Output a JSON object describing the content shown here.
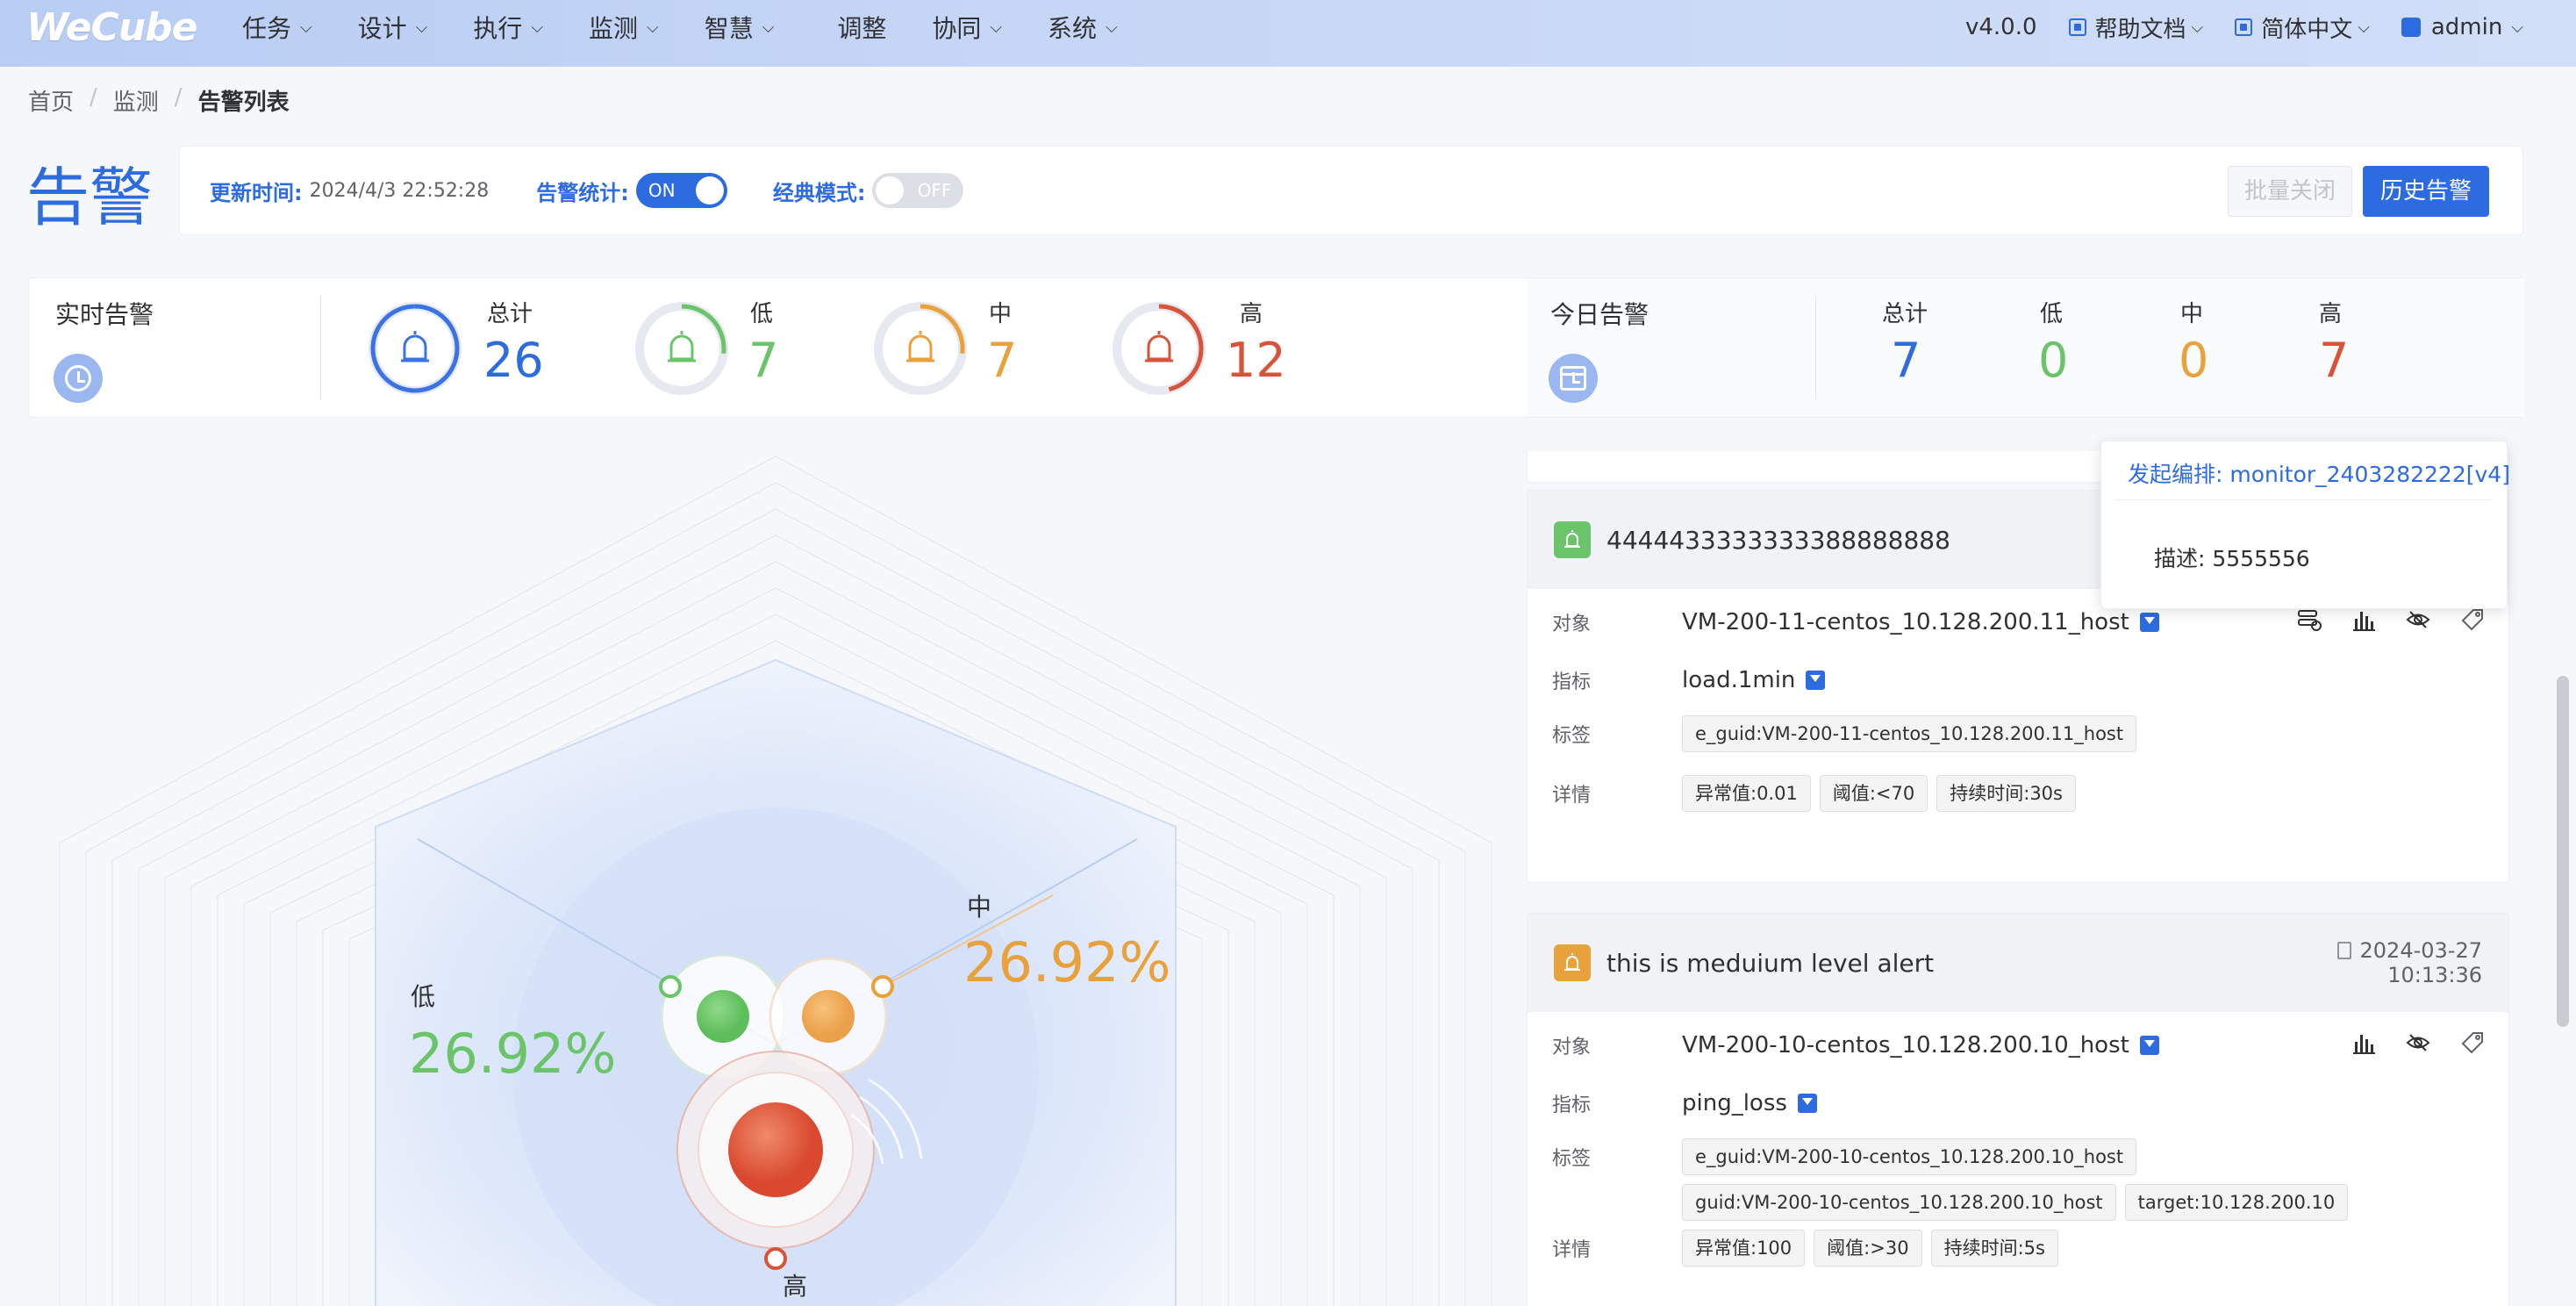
{
  "nav": {
    "logo": "WeCube",
    "items": [
      {
        "label": "任务",
        "chevron": true
      },
      {
        "label": "设计",
        "chevron": true
      },
      {
        "label": "执行",
        "chevron": true
      },
      {
        "label": "监测",
        "chevron": true
      },
      {
        "label": "智慧",
        "chevron": true
      },
      {
        "label": "调整",
        "chevron": false
      },
      {
        "label": "协同",
        "chevron": true
      },
      {
        "label": "系统",
        "chevron": true
      }
    ],
    "version": "v4.0.0",
    "help": "帮助文档",
    "language": "简体中文",
    "user": "admin"
  },
  "breadcrumb": [
    "首页",
    "监测",
    "告警列表"
  ],
  "page": {
    "title": "告警",
    "update_label": "更新时间:",
    "update_time": "2024/4/3 22:52:28",
    "stats_label": "告警统计:",
    "stats_toggle": "ON",
    "classic_label": "经典模式:",
    "classic_toggle": "OFF",
    "batch_close": "批量关闭",
    "history": "历史告警"
  },
  "realtime": {
    "title": "实时告警",
    "total_label": "总计",
    "total": "26",
    "low_label": "低",
    "low": "7",
    "mid_label": "中",
    "mid": "7",
    "high_label": "高",
    "high": "12"
  },
  "today": {
    "title": "今日告警",
    "total_label": "总计",
    "total": "7",
    "low_label": "低",
    "low": "0",
    "mid_label": "中",
    "mid": "0",
    "high_label": "高",
    "high": "7"
  },
  "radar": {
    "low_label": "低",
    "low_pct": "26.92%",
    "mid_label": "中",
    "mid_pct": "26.92%",
    "high_label": "高"
  },
  "colors": {
    "primary": "#2d6be0",
    "low": "#6cc46a",
    "mid": "#e9a23b",
    "high": "#d7543a"
  },
  "alerts": [
    {
      "level": "low",
      "title": "4444433333333388888888",
      "object_label": "对象",
      "object": "VM-200-11-centos_10.128.200.11_host",
      "metric_label": "指标",
      "metric": "load.1min",
      "tags_label": "标签",
      "tags": [
        "e_guid:VM-200-11-centos_10.128.200.11_host"
      ],
      "detail_label": "详情",
      "details": [
        "异常值:0.01",
        "阈值:<70",
        "持续时间:30s"
      ]
    },
    {
      "level": "mid",
      "title": "this is meduium level alert",
      "date": "2024-03-27",
      "time": "10:13:36",
      "object_label": "对象",
      "object": "VM-200-10-centos_10.128.200.10_host",
      "metric_label": "指标",
      "metric": "ping_loss",
      "tags_label": "标签",
      "tags": [
        "e_guid:VM-200-10-centos_10.128.200.10_host",
        "guid:VM-200-10-centos_10.128.200.10_host",
        "target:10.128.200.10"
      ],
      "detail_label": "详情",
      "details": [
        "异常值:100",
        "阈值:>30",
        "持续时间:5s"
      ]
    }
  ],
  "popover": {
    "title": "发起编排: monitor_2403282222[v4]",
    "desc": "描述: 5555556"
  }
}
